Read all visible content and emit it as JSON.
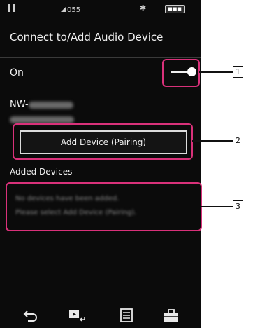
{
  "status_bar": {
    "volume": "055",
    "bluetooth_icon": "bluetooth-icon",
    "battery_label": "■■■"
  },
  "screen": {
    "title": "Connect to/Add Audio Device",
    "on_label": "On",
    "toggle_state": "on",
    "device_name_prefix": "NW-",
    "add_device_button": "Add Device (Pairing)",
    "added_devices_header": "Added Devices",
    "no_devices_line1": "No devices have been added.",
    "no_devices_line2": "Please select Add Device (Pairing)."
  },
  "nav": {
    "back_icon": "back-arrow-icon",
    "playback_icon": "now-playing-icon",
    "library_icon": "library-icon",
    "toolbox_icon": "toolbox-icon"
  },
  "callouts": {
    "c1": "1",
    "c2": "2",
    "c3": "3"
  },
  "colors": {
    "device_bg": "#0b0b0b",
    "callout_border": "#d9317a"
  }
}
